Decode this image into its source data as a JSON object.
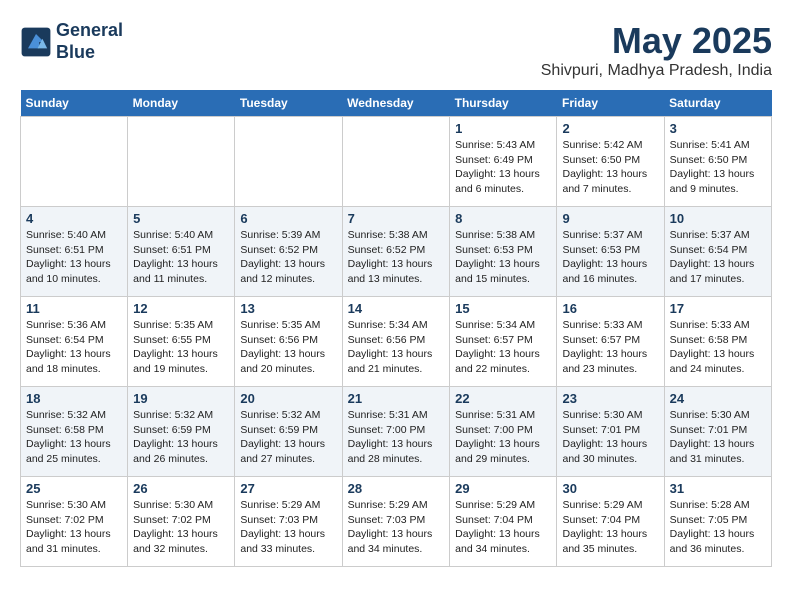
{
  "header": {
    "logo_line1": "General",
    "logo_line2": "Blue",
    "month": "May 2025",
    "location": "Shivpuri, Madhya Pradesh, India"
  },
  "weekdays": [
    "Sunday",
    "Monday",
    "Tuesday",
    "Wednesday",
    "Thursday",
    "Friday",
    "Saturday"
  ],
  "weeks": [
    [
      {
        "day": "",
        "text": ""
      },
      {
        "day": "",
        "text": ""
      },
      {
        "day": "",
        "text": ""
      },
      {
        "day": "",
        "text": ""
      },
      {
        "day": "1",
        "text": "Sunrise: 5:43 AM\nSunset: 6:49 PM\nDaylight: 13 hours and 6 minutes."
      },
      {
        "day": "2",
        "text": "Sunrise: 5:42 AM\nSunset: 6:50 PM\nDaylight: 13 hours and 7 minutes."
      },
      {
        "day": "3",
        "text": "Sunrise: 5:41 AM\nSunset: 6:50 PM\nDaylight: 13 hours and 9 minutes."
      }
    ],
    [
      {
        "day": "4",
        "text": "Sunrise: 5:40 AM\nSunset: 6:51 PM\nDaylight: 13 hours and 10 minutes."
      },
      {
        "day": "5",
        "text": "Sunrise: 5:40 AM\nSunset: 6:51 PM\nDaylight: 13 hours and 11 minutes."
      },
      {
        "day": "6",
        "text": "Sunrise: 5:39 AM\nSunset: 6:52 PM\nDaylight: 13 hours and 12 minutes."
      },
      {
        "day": "7",
        "text": "Sunrise: 5:38 AM\nSunset: 6:52 PM\nDaylight: 13 hours and 13 minutes."
      },
      {
        "day": "8",
        "text": "Sunrise: 5:38 AM\nSunset: 6:53 PM\nDaylight: 13 hours and 15 minutes."
      },
      {
        "day": "9",
        "text": "Sunrise: 5:37 AM\nSunset: 6:53 PM\nDaylight: 13 hours and 16 minutes."
      },
      {
        "day": "10",
        "text": "Sunrise: 5:37 AM\nSunset: 6:54 PM\nDaylight: 13 hours and 17 minutes."
      }
    ],
    [
      {
        "day": "11",
        "text": "Sunrise: 5:36 AM\nSunset: 6:54 PM\nDaylight: 13 hours and 18 minutes."
      },
      {
        "day": "12",
        "text": "Sunrise: 5:35 AM\nSunset: 6:55 PM\nDaylight: 13 hours and 19 minutes."
      },
      {
        "day": "13",
        "text": "Sunrise: 5:35 AM\nSunset: 6:56 PM\nDaylight: 13 hours and 20 minutes."
      },
      {
        "day": "14",
        "text": "Sunrise: 5:34 AM\nSunset: 6:56 PM\nDaylight: 13 hours and 21 minutes."
      },
      {
        "day": "15",
        "text": "Sunrise: 5:34 AM\nSunset: 6:57 PM\nDaylight: 13 hours and 22 minutes."
      },
      {
        "day": "16",
        "text": "Sunrise: 5:33 AM\nSunset: 6:57 PM\nDaylight: 13 hours and 23 minutes."
      },
      {
        "day": "17",
        "text": "Sunrise: 5:33 AM\nSunset: 6:58 PM\nDaylight: 13 hours and 24 minutes."
      }
    ],
    [
      {
        "day": "18",
        "text": "Sunrise: 5:32 AM\nSunset: 6:58 PM\nDaylight: 13 hours and 25 minutes."
      },
      {
        "day": "19",
        "text": "Sunrise: 5:32 AM\nSunset: 6:59 PM\nDaylight: 13 hours and 26 minutes."
      },
      {
        "day": "20",
        "text": "Sunrise: 5:32 AM\nSunset: 6:59 PM\nDaylight: 13 hours and 27 minutes."
      },
      {
        "day": "21",
        "text": "Sunrise: 5:31 AM\nSunset: 7:00 PM\nDaylight: 13 hours and 28 minutes."
      },
      {
        "day": "22",
        "text": "Sunrise: 5:31 AM\nSunset: 7:00 PM\nDaylight: 13 hours and 29 minutes."
      },
      {
        "day": "23",
        "text": "Sunrise: 5:30 AM\nSunset: 7:01 PM\nDaylight: 13 hours and 30 minutes."
      },
      {
        "day": "24",
        "text": "Sunrise: 5:30 AM\nSunset: 7:01 PM\nDaylight: 13 hours and 31 minutes."
      }
    ],
    [
      {
        "day": "25",
        "text": "Sunrise: 5:30 AM\nSunset: 7:02 PM\nDaylight: 13 hours and 31 minutes."
      },
      {
        "day": "26",
        "text": "Sunrise: 5:30 AM\nSunset: 7:02 PM\nDaylight: 13 hours and 32 minutes."
      },
      {
        "day": "27",
        "text": "Sunrise: 5:29 AM\nSunset: 7:03 PM\nDaylight: 13 hours and 33 minutes."
      },
      {
        "day": "28",
        "text": "Sunrise: 5:29 AM\nSunset: 7:03 PM\nDaylight: 13 hours and 34 minutes."
      },
      {
        "day": "29",
        "text": "Sunrise: 5:29 AM\nSunset: 7:04 PM\nDaylight: 13 hours and 34 minutes."
      },
      {
        "day": "30",
        "text": "Sunrise: 5:29 AM\nSunset: 7:04 PM\nDaylight: 13 hours and 35 minutes."
      },
      {
        "day": "31",
        "text": "Sunrise: 5:28 AM\nSunset: 7:05 PM\nDaylight: 13 hours and 36 minutes."
      }
    ]
  ]
}
